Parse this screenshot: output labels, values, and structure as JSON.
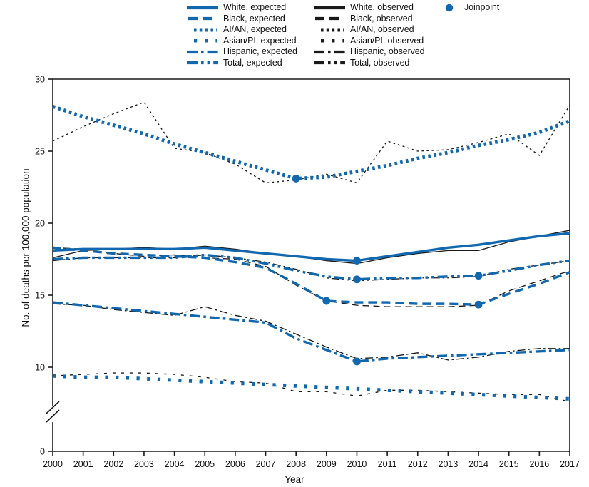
{
  "legend": {
    "columns": [
      {
        "name": "expected-column",
        "items": [
          {
            "label": "White, expected",
            "style": "solid",
            "color": "#1268ae",
            "icon": "line-key-solid"
          },
          {
            "label": "Black, expected",
            "style": "dash",
            "color": "#1268ae",
            "icon": "line-key-dash"
          },
          {
            "label": "AI/AN, expected",
            "style": "dot",
            "color": "#1268ae",
            "icon": "line-key-dot"
          },
          {
            "label": "Asian/PI, expected",
            "style": "sparsedot",
            "color": "#1268ae",
            "icon": "line-key-sparsedot"
          },
          {
            "label": "Hispanic, expected",
            "style": "dashdot",
            "color": "#1268ae",
            "icon": "line-key-dashdot"
          },
          {
            "label": "Total, expected",
            "style": "dashdotdot",
            "color": "#1268ae",
            "icon": "line-key-dashdotdot"
          }
        ]
      },
      {
        "name": "observed-column",
        "items": [
          {
            "label": "White, observed",
            "style": "solid",
            "color": "#1a1a1a",
            "icon": "line-key-solid"
          },
          {
            "label": "Black, observed",
            "style": "dash",
            "color": "#1a1a1a",
            "icon": "line-key-dash"
          },
          {
            "label": "AI/AN, observed",
            "style": "dot",
            "color": "#1a1a1a",
            "icon": "line-key-dot"
          },
          {
            "label": "Asian/PI, observed",
            "style": "sparsedot",
            "color": "#1a1a1a",
            "icon": "line-key-sparsedot"
          },
          {
            "label": "Hispanic, observed",
            "style": "dashdot",
            "color": "#1a1a1a",
            "icon": "line-key-dashdot"
          },
          {
            "label": "Total, observed",
            "style": "dashdotdot",
            "color": "#1a1a1a",
            "icon": "line-key-dashdotdot"
          }
        ]
      },
      {
        "name": "joinpoint-column",
        "items": [
          {
            "label": "Joinpoint",
            "style": "marker",
            "color": "#1268ae",
            "icon": "joinpoint-marker"
          }
        ]
      }
    ]
  },
  "colors": {
    "expected": "#1268ae",
    "observed": "#1a1a1a",
    "axis": "#1a1a1a",
    "background": "#ffffff"
  },
  "chart_data": {
    "type": "line",
    "title": "",
    "xlabel": "Year",
    "ylabel": "No. of deaths per 100,000 population",
    "grid": false,
    "legend_position": "top",
    "x": [
      2000,
      2001,
      2002,
      2003,
      2004,
      2005,
      2006,
      2007,
      2008,
      2009,
      2010,
      2011,
      2012,
      2013,
      2014,
      2015,
      2016,
      2017
    ],
    "xlim": [
      2000,
      2017
    ],
    "ylim": [
      0,
      30
    ],
    "y_ticks": [
      0,
      10,
      15,
      20,
      25,
      30
    ],
    "y_axis_break": {
      "present": true,
      "between": [
        0,
        10
      ]
    },
    "series": [
      {
        "name": "White, expected",
        "group": "White",
        "kind": "expected",
        "style": "solid",
        "color": "#1268ae",
        "values": [
          18.1,
          18.2,
          18.2,
          18.2,
          18.2,
          18.3,
          18.1,
          17.9,
          17.7,
          17.5,
          17.4,
          17.7,
          18.0,
          18.3,
          18.5,
          18.8,
          19.1,
          19.3
        ]
      },
      {
        "name": "White, observed",
        "group": "White",
        "kind": "observed",
        "style": "solid",
        "color": "#1a1a1a",
        "values": [
          17.6,
          18.1,
          18.2,
          18.3,
          18.2,
          18.4,
          18.2,
          17.9,
          17.7,
          17.4,
          17.2,
          17.6,
          17.9,
          18.1,
          18.1,
          18.7,
          19.1,
          19.5
        ]
      },
      {
        "name": "Black, expected",
        "group": "Black",
        "kind": "expected",
        "style": "dash",
        "color": "#1268ae",
        "values": [
          18.3,
          18.1,
          17.9,
          17.8,
          17.7,
          17.6,
          17.3,
          16.9,
          15.8,
          14.6,
          14.5,
          14.5,
          14.4,
          14.4,
          14.35,
          15.1,
          15.8,
          16.6
        ]
      },
      {
        "name": "Black, observed",
        "group": "Black",
        "kind": "observed",
        "style": "dash",
        "color": "#1a1a1a",
        "values": [
          18.3,
          18.2,
          17.9,
          17.7,
          17.8,
          17.6,
          17.5,
          17.0,
          15.7,
          14.6,
          14.3,
          14.2,
          14.2,
          14.2,
          14.3,
          15.3,
          16.0,
          16.7
        ]
      },
      {
        "name": "AI/AN, expected",
        "group": "AI/AN",
        "kind": "expected",
        "style": "dot",
        "color": "#1268ae",
        "values": [
          28.1,
          27.4,
          26.8,
          26.2,
          25.5,
          24.9,
          24.3,
          23.7,
          23.1,
          23.2,
          23.6,
          24.0,
          24.5,
          24.9,
          25.4,
          25.8,
          26.3,
          27.1
        ]
      },
      {
        "name": "AI/AN, observed",
        "group": "AI/AN",
        "kind": "observed",
        "style": "dot",
        "color": "#1a1a1a",
        "values": [
          25.7,
          26.7,
          27.6,
          28.4,
          25.2,
          24.9,
          24.1,
          22.8,
          23.0,
          23.4,
          22.8,
          25.7,
          25.0,
          25.1,
          25.6,
          26.2,
          24.7,
          28.2
        ]
      },
      {
        "name": "Asian/PI, expected",
        "group": "Asian/PI",
        "kind": "expected",
        "style": "sparsedot",
        "color": "#1268ae",
        "values": [
          9.4,
          9.3,
          9.3,
          9.2,
          9.1,
          9.0,
          8.9,
          8.8,
          8.7,
          8.6,
          8.5,
          8.4,
          8.3,
          8.2,
          8.1,
          8.0,
          7.9,
          7.8
        ]
      },
      {
        "name": "Asian/PI, observed",
        "group": "Asian/PI",
        "kind": "observed",
        "style": "sparsedot",
        "color": "#1a1a1a",
        "values": [
          9.4,
          9.5,
          9.6,
          9.6,
          9.5,
          9.3,
          9.0,
          8.9,
          8.3,
          8.3,
          8.0,
          8.4,
          8.4,
          8.3,
          8.2,
          8.1,
          8.1,
          7.6
        ]
      },
      {
        "name": "Hispanic, expected",
        "group": "Hispanic",
        "kind": "expected",
        "style": "dashdot",
        "color": "#1268ae",
        "values": [
          14.5,
          14.3,
          14.1,
          13.9,
          13.7,
          13.5,
          13.3,
          13.1,
          12.0,
          11.2,
          10.4,
          10.6,
          10.7,
          10.8,
          10.9,
          11.0,
          11.1,
          11.2
        ]
      },
      {
        "name": "Hispanic, observed",
        "group": "Hispanic",
        "kind": "observed",
        "style": "dashdot",
        "color": "#1a1a1a",
        "values": [
          14.4,
          14.3,
          14.0,
          13.8,
          13.6,
          14.2,
          13.6,
          13.2,
          12.3,
          11.4,
          10.6,
          10.7,
          11.0,
          10.5,
          10.7,
          11.1,
          11.3,
          11.3
        ]
      },
      {
        "name": "Total, expected",
        "group": "Total",
        "kind": "expected",
        "style": "dashdotdot",
        "color": "#1268ae",
        "values": [
          17.5,
          17.6,
          17.6,
          17.6,
          17.6,
          17.8,
          17.6,
          17.2,
          16.7,
          16.3,
          16.1,
          16.2,
          16.2,
          16.3,
          16.35,
          16.7,
          17.1,
          17.4
        ]
      },
      {
        "name": "Total, observed",
        "group": "Total",
        "kind": "observed",
        "style": "dashdotdot",
        "color": "#1a1a1a",
        "values": [
          17.4,
          17.6,
          17.6,
          17.6,
          17.6,
          17.8,
          17.6,
          17.3,
          16.8,
          16.2,
          16.0,
          16.1,
          16.2,
          16.2,
          16.3,
          16.8,
          17.1,
          17.4
        ]
      }
    ],
    "joinpoints": [
      {
        "series": "AI/AN, expected",
        "x": 2008,
        "y": 23.1
      },
      {
        "series": "White, expected",
        "x": 2010,
        "y": 17.4
      },
      {
        "series": "Total, expected",
        "x": 2010,
        "y": 16.1
      },
      {
        "series": "Total, expected",
        "x": 2014,
        "y": 16.35
      },
      {
        "series": "Black, expected",
        "x": 2009,
        "y": 14.6
      },
      {
        "series": "Black, expected",
        "x": 2014,
        "y": 14.35
      },
      {
        "series": "Hispanic, expected",
        "x": 2010,
        "y": 10.4
      }
    ]
  }
}
